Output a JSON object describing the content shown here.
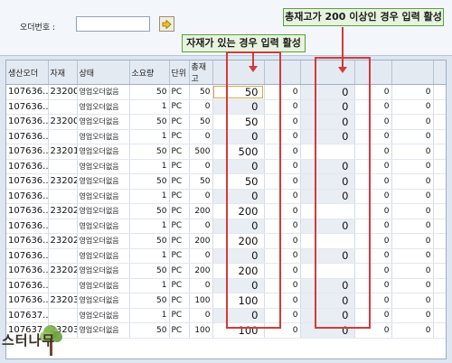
{
  "search": {
    "label": "오더번호 :",
    "value": "",
    "go_icon": "arrow-right-icon"
  },
  "callouts": {
    "stock_active": "자재가 있는 경우 입력 활성",
    "total_active": "총재고가 200 이상인 경우 입력 활성"
  },
  "grid": {
    "headers": [
      "생산오더",
      "자재",
      "상태",
      "소요량",
      "단위",
      "총재고",
      "",
      "",
      "",
      "",
      ""
    ],
    "rows": [
      {
        "order": "107636...",
        "material": "23200...",
        "status": "영업오더없음",
        "qty": "50",
        "unit": "PC",
        "stock": "50",
        "input1": "50",
        "zero1": "0",
        "input2": "0",
        "c9": "0",
        "c10": "0"
      },
      {
        "order": "107636...",
        "material": "",
        "status": "영업오더없음",
        "qty": "1",
        "unit": "PC",
        "stock": "0",
        "input1": "0",
        "zero1": "0",
        "input2": "0",
        "c9": "0",
        "c10": "0"
      },
      {
        "order": "107636...",
        "material": "23200...",
        "status": "영업오더없음",
        "qty": "50",
        "unit": "PC",
        "stock": "50",
        "input1": "50",
        "zero1": "0",
        "input2": "0",
        "c9": "0",
        "c10": "0"
      },
      {
        "order": "107636...",
        "material": "",
        "status": "영업오더없음",
        "qty": "1",
        "unit": "PC",
        "stock": "0",
        "input1": "0",
        "zero1": "0",
        "input2": "0",
        "c9": "0",
        "c10": "0"
      },
      {
        "order": "107636...",
        "material": "23201...",
        "status": "영업오더없음",
        "qty": "50",
        "unit": "PC",
        "stock": "500",
        "input1": "500",
        "zero1": "0",
        "input2": "",
        "c9": "0",
        "c10": "0"
      },
      {
        "order": "107636...",
        "material": "",
        "status": "영업오더없음",
        "qty": "1",
        "unit": "PC",
        "stock": "0",
        "input1": "0",
        "zero1": "0",
        "input2": "0",
        "c9": "0",
        "c10": "0"
      },
      {
        "order": "107636...",
        "material": "23202...",
        "status": "영업오더없음",
        "qty": "50",
        "unit": "PC",
        "stock": "50",
        "input1": "50",
        "zero1": "0",
        "input2": "0",
        "c9": "0",
        "c10": "0"
      },
      {
        "order": "107636...",
        "material": "",
        "status": "영업오더없음",
        "qty": "1",
        "unit": "PC",
        "stock": "0",
        "input1": "0",
        "zero1": "0",
        "input2": "0",
        "c9": "0",
        "c10": "0"
      },
      {
        "order": "107636...",
        "material": "23202...",
        "status": "영업오더없음",
        "qty": "50",
        "unit": "PC",
        "stock": "200",
        "input1": "200",
        "zero1": "0",
        "input2": "",
        "c9": "0",
        "c10": "0"
      },
      {
        "order": "107636...",
        "material": "",
        "status": "영업오더없음",
        "qty": "1",
        "unit": "PC",
        "stock": "0",
        "input1": "0",
        "zero1": "0",
        "input2": "0",
        "c9": "0",
        "c10": "0"
      },
      {
        "order": "107636...",
        "material": "23202...",
        "status": "영업오더없음",
        "qty": "50",
        "unit": "PC",
        "stock": "200",
        "input1": "200",
        "zero1": "0",
        "input2": "",
        "c9": "0",
        "c10": "0"
      },
      {
        "order": "107636...",
        "material": "",
        "status": "영업오더없음",
        "qty": "1",
        "unit": "PC",
        "stock": "0",
        "input1": "0",
        "zero1": "0",
        "input2": "0",
        "c9": "0",
        "c10": "0"
      },
      {
        "order": "107636...",
        "material": "23202...",
        "status": "영업오더없음",
        "qty": "50",
        "unit": "PC",
        "stock": "200",
        "input1": "200",
        "zero1": "0",
        "input2": "",
        "c9": "0",
        "c10": "0"
      },
      {
        "order": "107636...",
        "material": "",
        "status": "영업오더없음",
        "qty": "1",
        "unit": "PC",
        "stock": "0",
        "input1": "0",
        "zero1": "0",
        "input2": "0",
        "c9": "0",
        "c10": "0"
      },
      {
        "order": "107636...",
        "material": "23203...",
        "status": "영업오더없음",
        "qty": "50",
        "unit": "PC",
        "stock": "100",
        "input1": "100",
        "zero1": "0",
        "input2": "0",
        "c9": "0",
        "c10": "0"
      },
      {
        "order": "107637...",
        "material": "",
        "status": "영업오더없음",
        "qty": "1",
        "unit": "PC",
        "stock": "0",
        "input1": "0",
        "zero1": "0",
        "input2": "0",
        "c9": "0",
        "c10": "0"
      },
      {
        "order": "107637...",
        "material": "23203...",
        "status": "영업오더없음",
        "qty": "50",
        "unit": "PC",
        "stock": "100",
        "input1": "100",
        "zero1": "0",
        "input2": "0",
        "c9": "0",
        "c10": "0"
      }
    ]
  },
  "logo": {
    "text": "스터나무",
    "icon": "tree-logo-icon"
  },
  "colors": {
    "highlight_red": "#d33a3a",
    "callout_green": "#58a23a",
    "active_cell": "#fde9b9",
    "disabled_cell": "#e9eef4"
  }
}
